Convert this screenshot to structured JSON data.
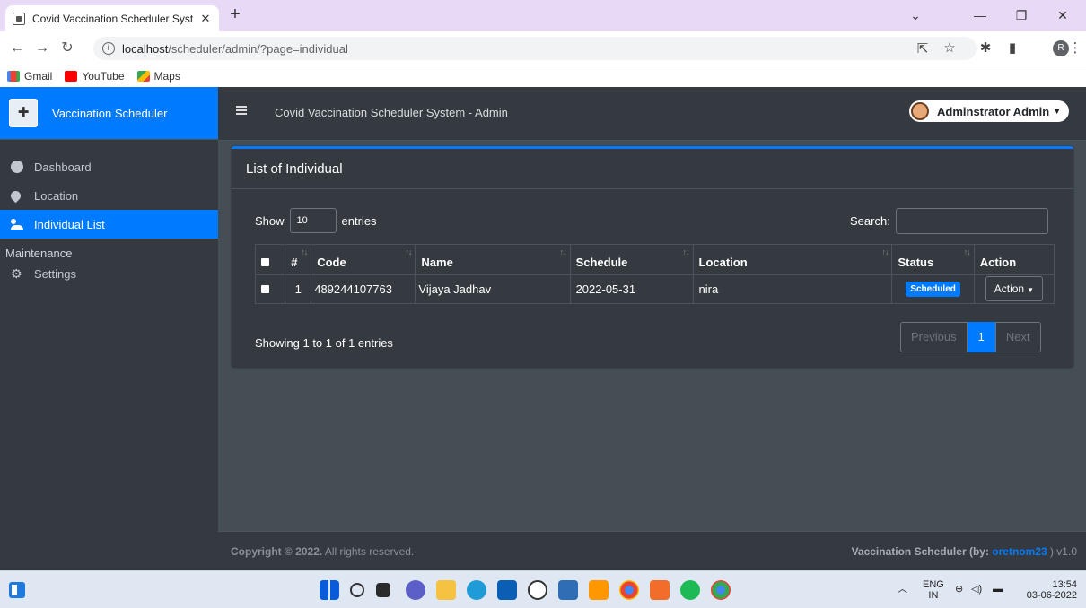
{
  "browser": {
    "tab_title": "Covid Vaccination Scheduler Syst",
    "tab_close": "✕",
    "new_tab": "+",
    "url_host": "localhost",
    "url_path": "/scheduler/admin/?page=individual",
    "profile_initial": "R",
    "bookmarks": [
      "Gmail",
      "YouTube",
      "Maps"
    ]
  },
  "app": {
    "brand": "Vaccination Scheduler",
    "system_title": "Covid Vaccination Scheduler System - Admin",
    "user_name": "Adminstrator Admin"
  },
  "sidebar": {
    "items": [
      {
        "label": "Dashboard",
        "icon": "dashboard-icon",
        "active": false
      },
      {
        "label": "Location",
        "icon": "map-marker-icon",
        "active": false
      },
      {
        "label": "Individual List",
        "icon": "users-icon",
        "active": true
      }
    ],
    "section_header": "Maintenance",
    "maintenance_items": [
      {
        "label": "Settings",
        "icon": "gears-icon",
        "active": false
      }
    ]
  },
  "card": {
    "title": "List of Individual",
    "show_label": "Show",
    "entries_value": "10",
    "entries_label": "entries",
    "search_label": "Search:",
    "search_value": ""
  },
  "table": {
    "columns": [
      "#",
      "Code",
      "Name",
      "Schedule",
      "Location",
      "Status",
      "Action"
    ],
    "rows": [
      {
        "num": "1",
        "code": "489244107763",
        "name": "Vijaya Jadhav",
        "schedule": "2022-05-31",
        "location": "nira",
        "status": "Scheduled",
        "action": "Action"
      }
    ]
  },
  "pagination": {
    "info": "Showing 1 to 1 of 1 entries",
    "previous": "Previous",
    "current": "1",
    "next": "Next"
  },
  "footer": {
    "copyright_bold": "Copyright © 2022.",
    "copyright_rest": " All rights reserved.",
    "credit_prefix": "Vaccination Scheduler (by: ",
    "credit_author": "oretnom23",
    "credit_suffix": " ) v1.0"
  },
  "taskbar": {
    "lang_top": "ENG",
    "lang_bottom": "IN",
    "time": "13:54",
    "date": "03-06-2022"
  },
  "colors": {
    "primary": "#007bff",
    "sidebar_bg": "#343a40",
    "content_bg": "#454d55"
  }
}
